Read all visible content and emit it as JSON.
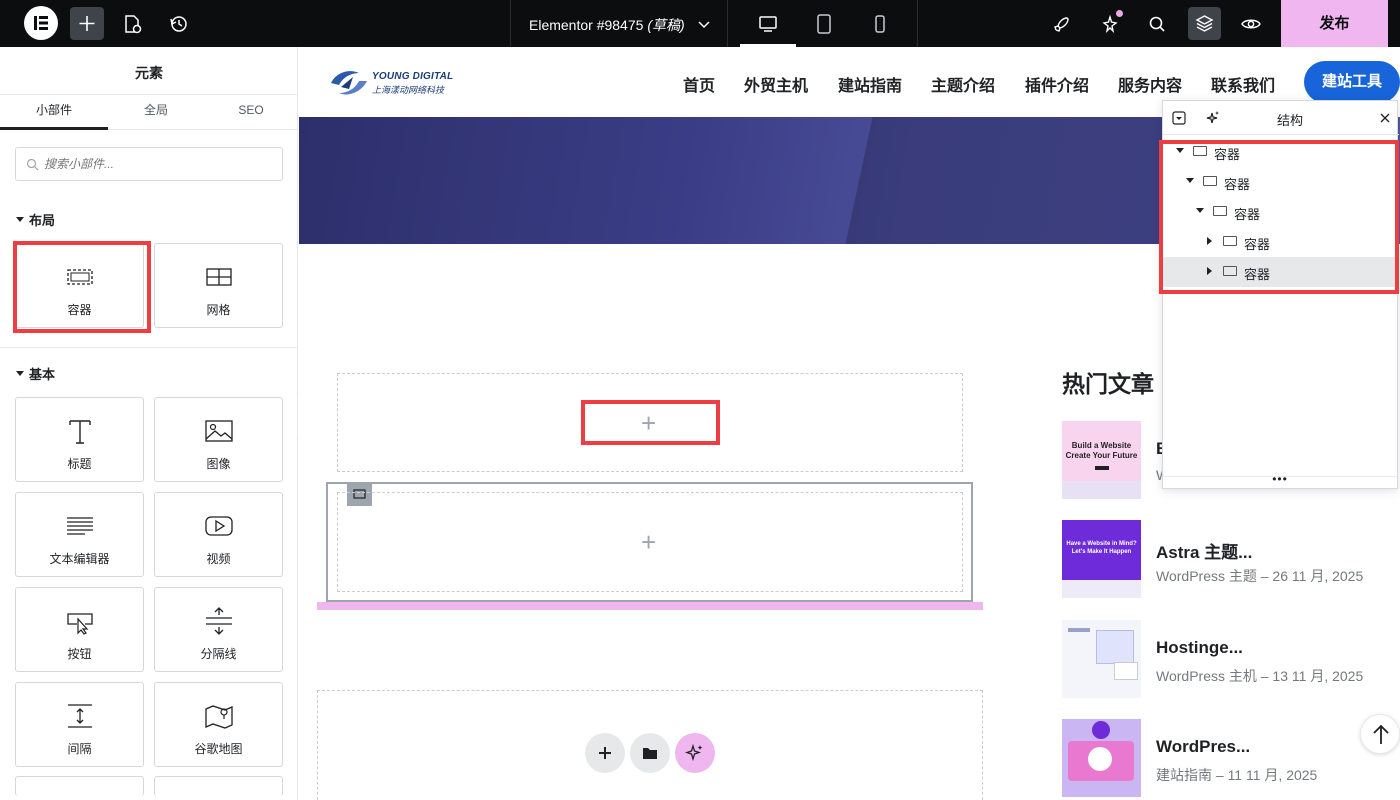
{
  "topbar": {
    "document_title": "Elementor #98475",
    "document_status": "(草稿)",
    "publish_label": "发布",
    "icons": [
      "elementor-logo-icon",
      "add-element-icon",
      "page-settings-icon",
      "history-icon",
      "chevron-down-icon",
      "desktop-icon",
      "tablet-icon",
      "mobile-icon",
      "rocket-icon",
      "notifications-icon",
      "search-icon",
      "structure-icon",
      "preview-eye-icon"
    ]
  },
  "panel": {
    "title": "元素",
    "tabs": [
      "小部件",
      "全局",
      "SEO"
    ],
    "active_tab": "小部件",
    "search_placeholder": "搜索小部件...",
    "sections": {
      "layout": {
        "title": "布局",
        "widgets": [
          "容器",
          "网格"
        ]
      },
      "basic": {
        "title": "基本",
        "widgets": [
          "标题",
          "图像",
          "文本编辑器",
          "视频",
          "按钮",
          "分隔线",
          "间隔",
          "谷歌地图"
        ]
      }
    }
  },
  "site": {
    "logo_en": "YOUNG DIGITAL",
    "logo_cn": "上海漾动网络科技",
    "nav": [
      "首页",
      "外贸主机",
      "建站指南",
      "主题介绍",
      "插件介绍",
      "服务内容",
      "联系我们"
    ],
    "nav_button": "建站工具",
    "sidebar_title": "热门文章",
    "posts": [
      {
        "title": "B",
        "meta": "W",
        "thumb_line1": "Build a Website",
        "thumb_line2": "Create Your Future"
      },
      {
        "title": "Astra 主题...",
        "meta": "WordPress 主题 – 26 11 月, 2025",
        "thumb_line1": "Have a Website in Mind?",
        "thumb_line2": "Let's Make It Happen"
      },
      {
        "title": "Hostinge...",
        "meta": "WordPress 主机 – 13 11 月, 2025",
        "thumb_line1": "",
        "thumb_line2": ""
      },
      {
        "title": "WordPres...",
        "meta": "建站指南 – 11 11 月, 2025",
        "thumb_line1": "",
        "thumb_line2": ""
      }
    ],
    "drop_plus": "+"
  },
  "structure": {
    "title": "结构",
    "tree": [
      {
        "label": "容器",
        "depth": 0,
        "expanded": true
      },
      {
        "label": "容器",
        "depth": 1,
        "expanded": true
      },
      {
        "label": "容器",
        "depth": 2,
        "expanded": true
      },
      {
        "label": "容器",
        "depth": 3,
        "expanded": false
      },
      {
        "label": "容器",
        "depth": 3,
        "expanded": false,
        "selected": true
      }
    ],
    "more": "•••"
  },
  "colors": {
    "accent_pink": "#f0b6f0",
    "highlight_red": "#ee3d43",
    "nav_button_blue": "#1765d8",
    "topbar_bg": "#0c0d0e"
  }
}
